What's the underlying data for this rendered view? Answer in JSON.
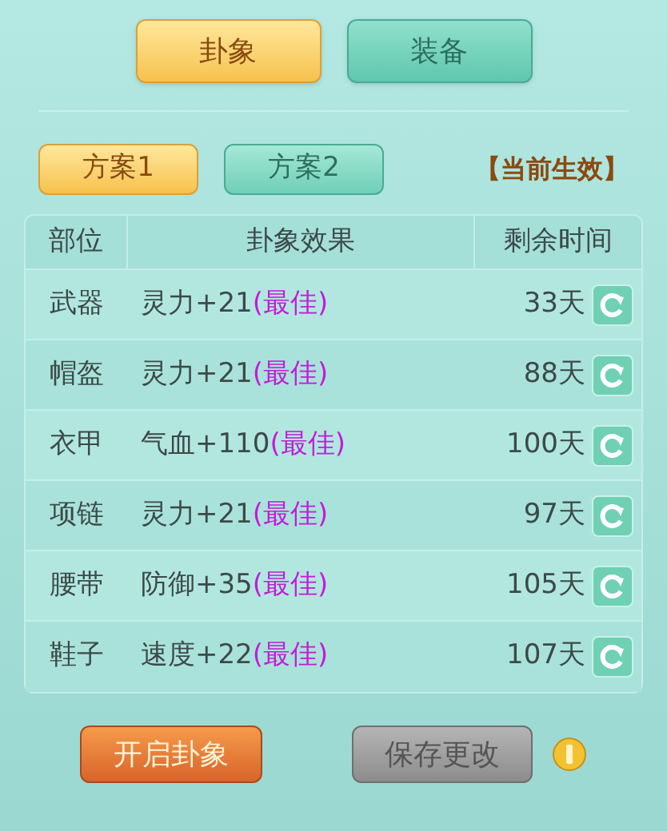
{
  "tabs": [
    {
      "label": "卦象",
      "selected": true
    },
    {
      "label": "装备",
      "selected": false
    }
  ],
  "plans": [
    {
      "label": "方案1",
      "selected": true
    },
    {
      "label": "方案2",
      "selected": false
    }
  ],
  "plan_status": "【当前生效】",
  "table": {
    "columns": [
      "部位",
      "卦象效果",
      "剩余时间"
    ],
    "rows": [
      {
        "slot": "武器",
        "effect": "灵力+21",
        "tag": "(最佳)",
        "time": "33天"
      },
      {
        "slot": "帽盔",
        "effect": "灵力+21",
        "tag": "(最佳)",
        "time": "88天"
      },
      {
        "slot": "衣甲",
        "effect": "气血+110",
        "tag": "(最佳)",
        "time": "100天"
      },
      {
        "slot": "项链",
        "effect": "灵力+21",
        "tag": "(最佳)",
        "time": "97天"
      },
      {
        "slot": "腰带",
        "effect": "防御+35",
        "tag": "(最佳)",
        "time": "105天"
      },
      {
        "slot": "鞋子",
        "effect": "速度+22",
        "tag": "(最佳)",
        "time": "107天"
      }
    ]
  },
  "buttons": [
    {
      "label": "开启卦象",
      "disabled": false
    },
    {
      "label": "保存更改",
      "disabled": true
    }
  ]
}
